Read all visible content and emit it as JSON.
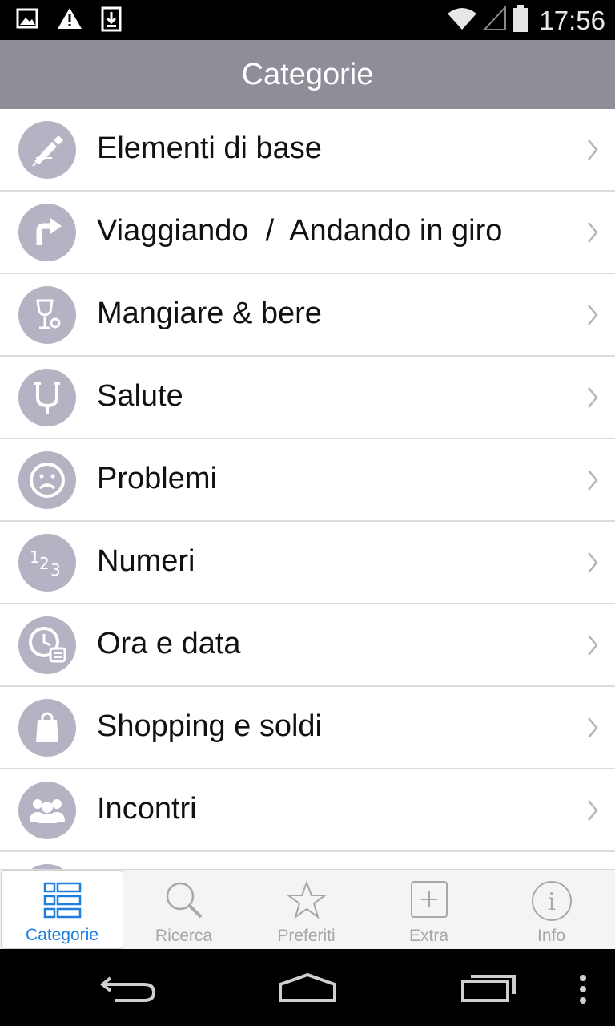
{
  "status_bar": {
    "time": "17:56",
    "left_icons": [
      "image-icon",
      "warning-icon",
      "download-icon"
    ],
    "right_icons": [
      "wifi-icon",
      "signal-icon",
      "battery-icon"
    ]
  },
  "header": {
    "title": "Categorie"
  },
  "categories": [
    {
      "label": "Elementi di base",
      "icon": "pencil-icon"
    },
    {
      "label": "Viaggiando  /  Andando in giro",
      "icon": "turn-right-arrow-icon"
    },
    {
      "label": "Mangiare & bere",
      "icon": "glass-bottle-icon"
    },
    {
      "label": "Salute",
      "icon": "stethoscope-icon"
    },
    {
      "label": "Problemi",
      "icon": "sad-face-icon"
    },
    {
      "label": "Numeri",
      "icon": "numbers-123-icon"
    },
    {
      "label": "Ora e data",
      "icon": "clock-calendar-icon"
    },
    {
      "label": "Shopping e soldi",
      "icon": "shopping-bag-icon"
    },
    {
      "label": "Incontri",
      "icon": "people-group-icon"
    }
  ],
  "tabs": [
    {
      "label": "Categorie",
      "icon": "grid-list-icon",
      "active": true
    },
    {
      "label": "Ricerca",
      "icon": "magnifier-icon",
      "active": false
    },
    {
      "label": "Preferiti",
      "icon": "star-icon",
      "active": false
    },
    {
      "label": "Extra",
      "icon": "plus-box-icon",
      "active": false
    },
    {
      "label": "Info",
      "icon": "info-icon",
      "active": false
    }
  ],
  "colors": {
    "header_bg": "#8e8e99",
    "icon_circle": "#b3b3c3",
    "active_tab": "#1c7fe0",
    "inactive_tab": "#a7a7a7"
  }
}
